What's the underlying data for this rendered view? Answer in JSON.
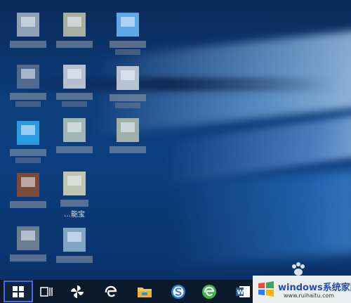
{
  "desktop": {
    "icons": [
      {
        "id": "icon-1"
      },
      {
        "id": "icon-2"
      },
      {
        "id": "icon-3"
      },
      {
        "id": "icon-4"
      },
      {
        "id": "icon-5"
      },
      {
        "id": "icon-6"
      },
      {
        "id": "icon-7"
      },
      {
        "id": "icon-8"
      },
      {
        "id": "icon-9"
      },
      {
        "id": "icon-10"
      },
      {
        "id": "icon-11",
        "label": "…能宝"
      },
      {
        "id": "icon-12"
      },
      {
        "id": "icon-13"
      }
    ]
  },
  "taskbar": {
    "items": [
      {
        "name": "start-button",
        "icon": "windows-logo-icon"
      },
      {
        "name": "task-view-button",
        "icon": "task-view-icon"
      },
      {
        "name": "pinwheel-app-button",
        "icon": "pinwheel-icon"
      },
      {
        "name": "edge-browser-button",
        "icon": "edge-icon"
      },
      {
        "name": "file-explorer-button",
        "icon": "folder-icon"
      },
      {
        "name": "sogou-browser-button",
        "icon": "s-icon"
      },
      {
        "name": "ie-browser-button",
        "icon": "ie-icon"
      },
      {
        "name": "word-button",
        "icon": "word-icon"
      }
    ]
  },
  "watermark": {
    "title": "windows系统家园",
    "subtitle": "www.ruihaitu.com"
  },
  "colors": {
    "desktop_bg": "#0c3f80",
    "taskbar_bg": "#0b1a2b",
    "start_highlight": "#3a6df0",
    "watermark_blue": "#1f4fb5"
  }
}
